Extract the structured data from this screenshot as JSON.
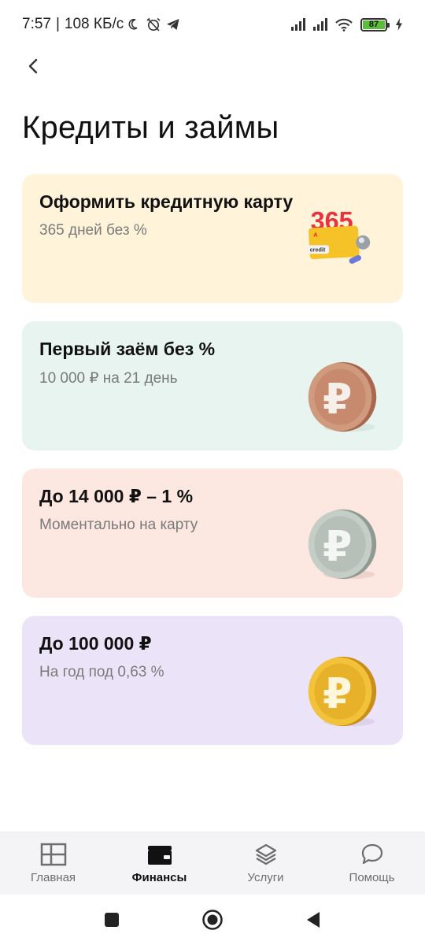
{
  "status": {
    "time": "7:57",
    "speed": "108 КБ/с",
    "battery": "87"
  },
  "page": {
    "title": "Кредиты и займы"
  },
  "cards": [
    {
      "title": "Оформить кредитную карту",
      "subtitle": "365 дней без %",
      "bg": "#fff3d9",
      "image_text": "365",
      "card_label": "credit"
    },
    {
      "title": "Первый заём без %",
      "subtitle": "10 000 ₽ на 21 день",
      "bg": "#e7f4f0",
      "coin": "bronze"
    },
    {
      "title": "До 14 000 ₽ – 1 %",
      "subtitle": "Моментально на карту",
      "bg": "#fde7e1",
      "coin": "silver"
    },
    {
      "title": "До 100 000 ₽",
      "subtitle": "На год под 0,63 %",
      "bg": "#ebe3f7",
      "coin": "gold"
    }
  ],
  "nav": [
    {
      "label": "Главная",
      "icon": "grid-icon",
      "active": false
    },
    {
      "label": "Финансы",
      "icon": "wallet-icon",
      "active": true
    },
    {
      "label": "Услуги",
      "icon": "layers-icon",
      "active": false
    },
    {
      "label": "Помощь",
      "icon": "chat-bubble-icon",
      "active": false
    }
  ]
}
